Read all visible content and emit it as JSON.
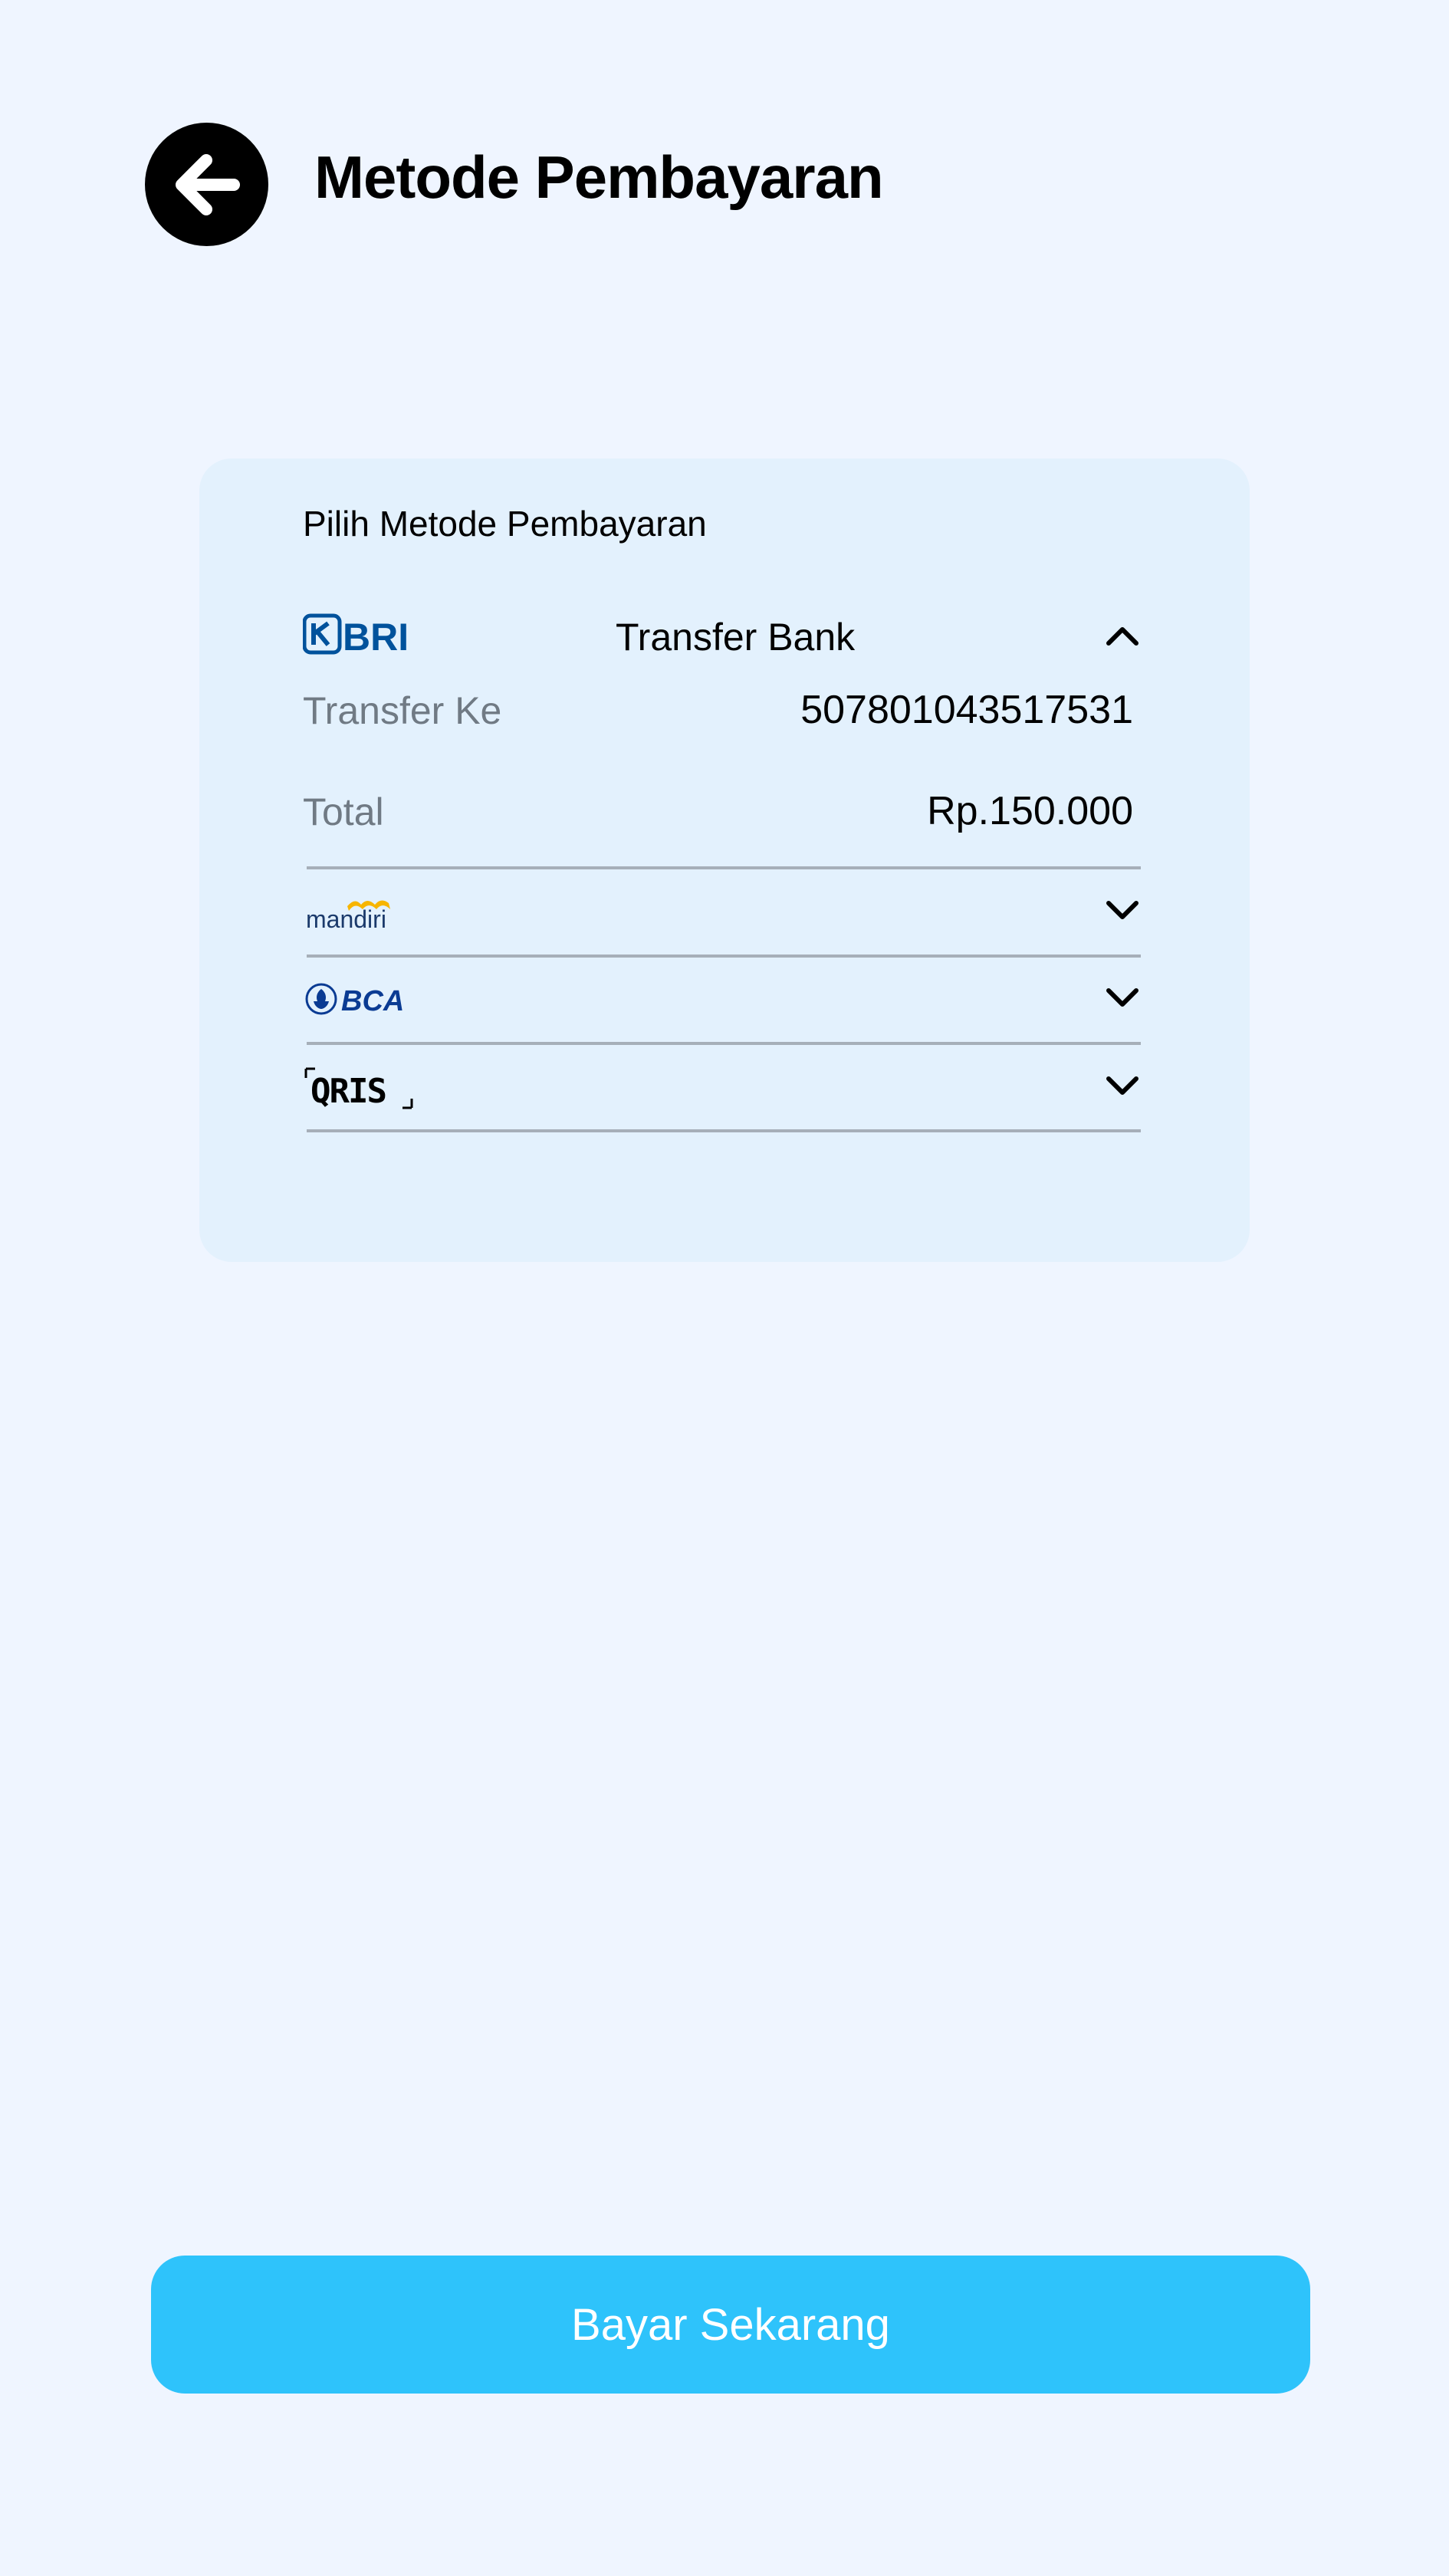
{
  "header": {
    "back_icon": "arrow-left-icon",
    "title": "Metode Pembayaran"
  },
  "payment_card": {
    "title": "Pilih Metode Pembayaran",
    "expanded_method": {
      "logo_text": "BRI",
      "name": "Transfer Bank",
      "chevron": "chevron-up-icon",
      "transfer_label": "Transfer Ke",
      "account_number": "507801043517531",
      "total_label": "Total",
      "total_value": "Rp.150.000"
    },
    "collapsed_methods": [
      {
        "logo_text": "mandiri",
        "chevron": "chevron-down-icon"
      },
      {
        "logo_text": "BCA",
        "chevron": "chevron-down-icon"
      },
      {
        "logo_text": "QRIS",
        "chevron": "chevron-down-icon"
      }
    ]
  },
  "footer": {
    "pay_button_label": "Bayar Sekarang"
  },
  "colors": {
    "background": "#eff5ff",
    "card": "#e3f1fd",
    "primary_button": "#2ec3fb",
    "bri_blue": "#00529c",
    "bca_blue": "#0a3b93",
    "mandiri_navy": "#1b3a6b",
    "mandiri_gold": "#f7b500",
    "muted_text": "#707a84",
    "divider": "#a6afb9"
  }
}
